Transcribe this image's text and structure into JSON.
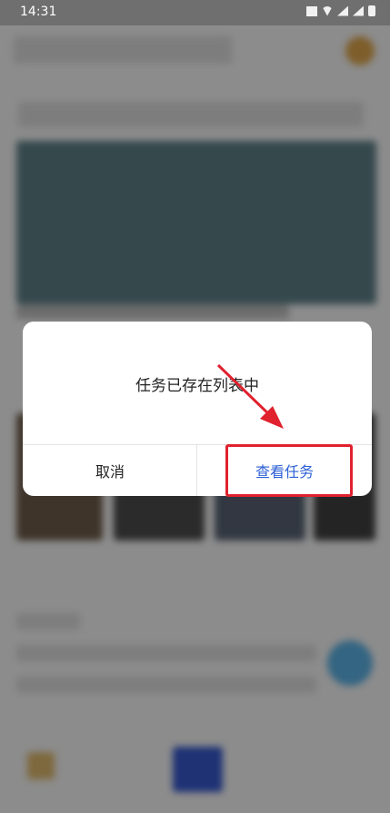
{
  "status": {
    "time": "14:31"
  },
  "dialog": {
    "message": "任务已存在列表中",
    "cancel_label": "取消",
    "confirm_label": "查看任务"
  },
  "colors": {
    "confirm_text": "#2b5fd6",
    "highlight_red": "#e0212e"
  }
}
